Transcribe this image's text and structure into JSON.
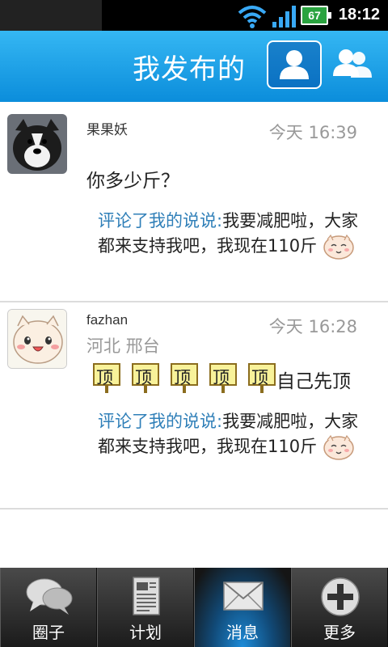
{
  "status_bar": {
    "time": "18:12",
    "battery": "67",
    "icons": [
      "wifi-icon",
      "signal-icon",
      "battery-icon"
    ]
  },
  "header": {
    "title": "我发布的",
    "buttons": [
      "person-icon",
      "group-icon"
    ]
  },
  "posts": [
    {
      "username": "果果妖",
      "time": "今天 16:39",
      "content": "你多少斤？",
      "comment_prefix": "评论了我的说说:",
      "comment_text": "我要减肥啦，大家都来支持我吧，我现在110斤"
    },
    {
      "username": "fazhan",
      "time": "今天 16:28",
      "location": "河北 邢台",
      "sticker_label": "顶",
      "content": "自己先顶",
      "comment_prefix": "评论了我的说说:",
      "comment_text": "我要减肥啦，大家都来支持我吧，我现在110斤"
    }
  ],
  "bottom_nav": [
    {
      "label": "圈子",
      "icon": "chat-bubbles-icon"
    },
    {
      "label": "计划",
      "icon": "document-icon"
    },
    {
      "label": "消息",
      "icon": "envelope-icon",
      "active": true
    },
    {
      "label": "更多",
      "icon": "plus-circle-icon"
    }
  ],
  "colors": {
    "header_blue": "#1a9fe6",
    "link_blue": "#2f7fb8",
    "active_tab": "#1d8bd8"
  }
}
